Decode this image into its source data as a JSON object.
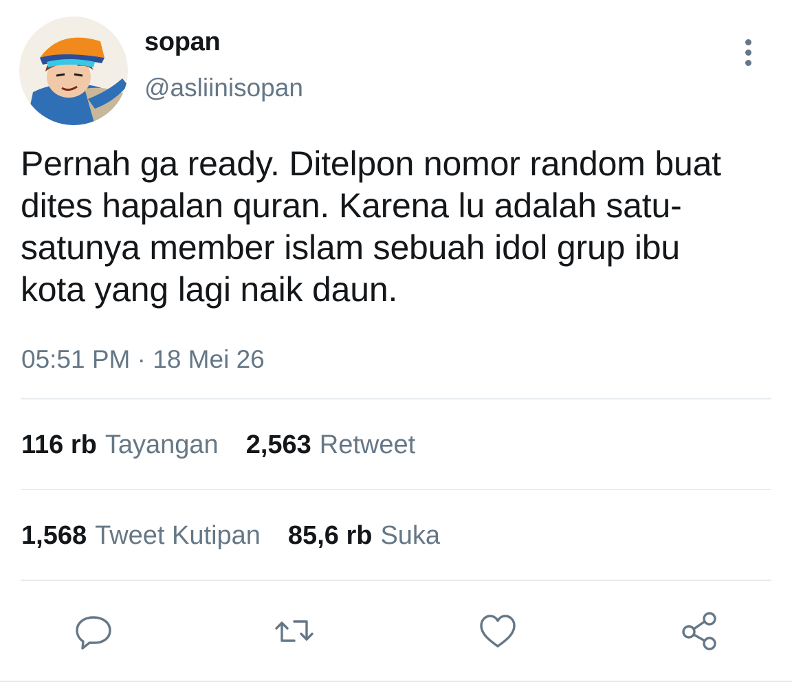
{
  "user": {
    "display_name": "sopan",
    "handle": "@asliinisopan",
    "avatar_icon": "avatar-icon"
  },
  "tweet": {
    "text_lines": [
      "Pernah ga ready. Ditelpon nomor random buat",
      "dites hapalan quran. Karena lu adalah satu-",
      "satunya member islam sebuah idol grup ibu",
      "kota yang lagi naik daun."
    ],
    "timestamp": "05:51 PM · 18 Mei 26"
  },
  "stats": {
    "views": {
      "value": "116 rb",
      "label": "Tayangan"
    },
    "retweets": {
      "value": "2,563",
      "label": "Retweet"
    },
    "quotes": {
      "value": "1,568",
      "label": "Tweet Kutipan"
    },
    "likes": {
      "value": "85,6 rb",
      "label": "Suka"
    }
  },
  "actions": [
    {
      "name": "reply",
      "icon": "reply-icon"
    },
    {
      "name": "retweet",
      "icon": "retweet-icon"
    },
    {
      "name": "like",
      "icon": "heart-icon"
    },
    {
      "name": "share",
      "icon": "share-icon"
    }
  ],
  "colors": {
    "primary_text": "#14171a",
    "secondary_text": "#657786",
    "divider": "#e6ecf0",
    "icon": "#657786"
  }
}
